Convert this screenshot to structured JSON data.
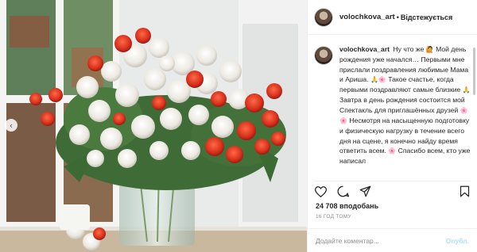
{
  "post": {
    "username": "volochkova_art",
    "follow_separator": "•",
    "follow_label": "Відстежується",
    "caption_prefix": "Ну что же",
    "caption_1": "Мой день рождения уже начался…",
    "caption_2": "Первыми мне прислали поздравления любимые Мама и Ариша.",
    "caption_3": "Такое счастье, когда первыми поздравляют самые близкие",
    "caption_4": "Завтра в день рождения состоится мой Спектакль для приглашённых друзей",
    "caption_5": "Несмотря на насыщенную подготовку и физическую нагрузку в течение всего дня на сцене, я конечно найду время ответить всем.",
    "caption_6": "Спасибо всем, кто уже написал",
    "likes": "24 708 вподобань",
    "date": "16 ГОД ТОМУ",
    "comment_placeholder": "Додайте коментар...",
    "publish_label": "Опубл."
  },
  "icons": {
    "carousel_prev": "chevron-left-icon",
    "like": "heart-icon",
    "comment": "comment-icon",
    "share": "share-icon",
    "save": "bookmark-icon"
  },
  "colors": {
    "follow_text": "#262626",
    "muted": "#8e8e8e",
    "publish_disabled": "#b2dffc"
  }
}
